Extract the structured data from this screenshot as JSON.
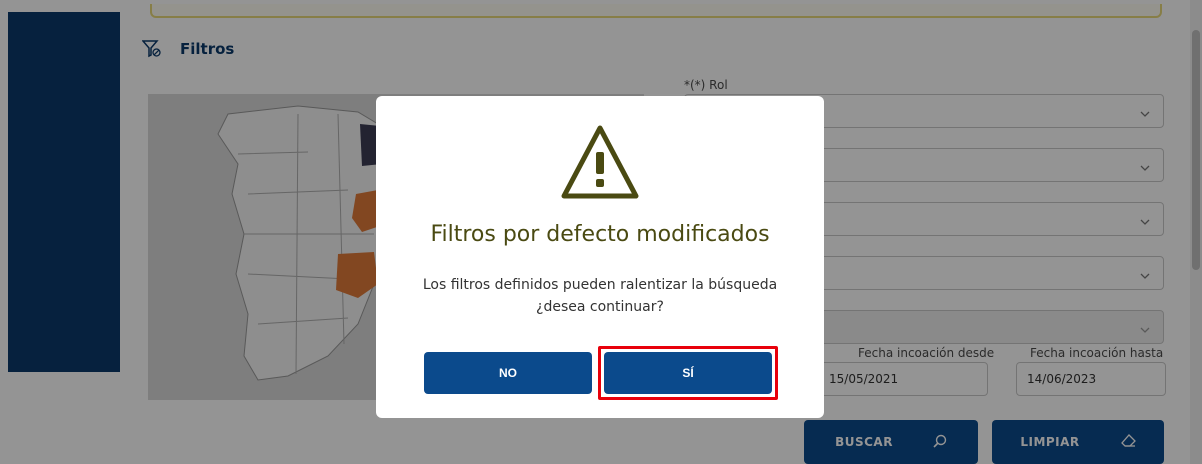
{
  "filters": {
    "title": "Filtros"
  },
  "form": {
    "rol_label": "*(*) Rol",
    "fecha_desde_label": "Fecha incoación desde",
    "fecha_hasta_label": "Fecha incoación hasta",
    "fecha_desde_value": "15/05/2021",
    "fecha_hasta_value": "14/06/2023",
    "buscar_label": "BUSCAR",
    "limpiar_label": "LIMPIAR"
  },
  "modal": {
    "title": "Filtros por defecto modificados",
    "message_line1": "Los filtros definidos pueden ralentizar la búsqueda",
    "message_line2": "¿desea continuar?",
    "no_label": "NO",
    "si_label": "SÍ"
  },
  "icons": {
    "filter": "filter-icon",
    "warning": "warning-triangle-icon",
    "search": "search-icon",
    "eraser": "eraser-icon",
    "chevron": "chevron-down-icon"
  },
  "colors": {
    "primary": "#0b4a8c",
    "navy": "#0b3a6b",
    "warning": "#4a4a12",
    "highlight": "#e8000b",
    "map_orange": "#e07a3a",
    "map_dark": "#3d3d55"
  }
}
